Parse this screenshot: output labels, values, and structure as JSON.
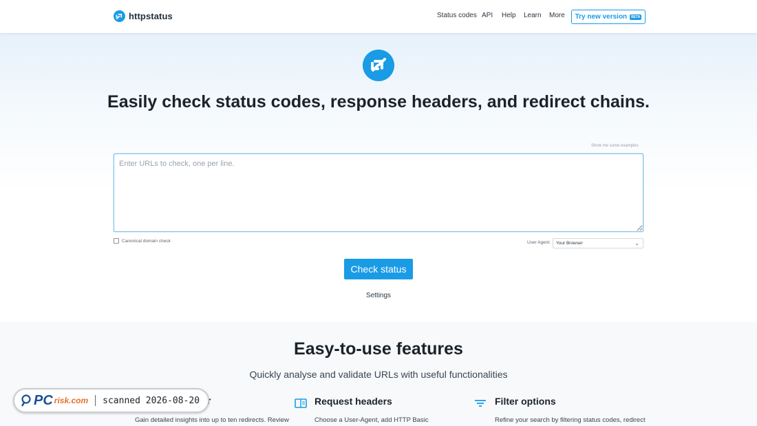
{
  "header": {
    "brand": "httpstatus",
    "nav": [
      "Status codes",
      "API",
      "Help",
      "Learn",
      "More"
    ],
    "try_label": "Try new version",
    "beta_badge": "BETA"
  },
  "hero": {
    "headline_parts": [
      "Easily check ",
      "status codes",
      ", ",
      "response headers",
      ", and ",
      "redirect chains",
      "."
    ],
    "examples_link": "Show me some examples",
    "url_placeholder": "Enter URLs to check, one per line.",
    "canonical_label": "Canonical domain check",
    "user_agent_label": "User Agent:",
    "user_agent_value": "Your Browser",
    "check_button": "Check status",
    "settings_link": "Settings"
  },
  "features": {
    "title": "Easy-to-use features",
    "subtitle": "Quickly analyse and validate URLs with useful functionalities",
    "items": [
      {
        "title": "r",
        "desc": "Gain detailed insights into up to ten redirects. Review",
        "icon": "redirect-icon"
      },
      {
        "title": "Request headers",
        "desc": "Choose a User-Agent, add HTTP Basic",
        "icon": "book-icon"
      },
      {
        "title": "Filter options",
        "desc": "Refine your search by filtering status codes, redirect",
        "icon": "filter-icon"
      }
    ]
  },
  "watermark": {
    "pc": "PC",
    "risk": "risk.com",
    "text": "scanned 2026-08-20"
  },
  "colors": {
    "accent": "#1a9be6",
    "text": "#1b2229",
    "hero_bg": "#e6f1fb",
    "features_bg": "#f7f9fb"
  }
}
